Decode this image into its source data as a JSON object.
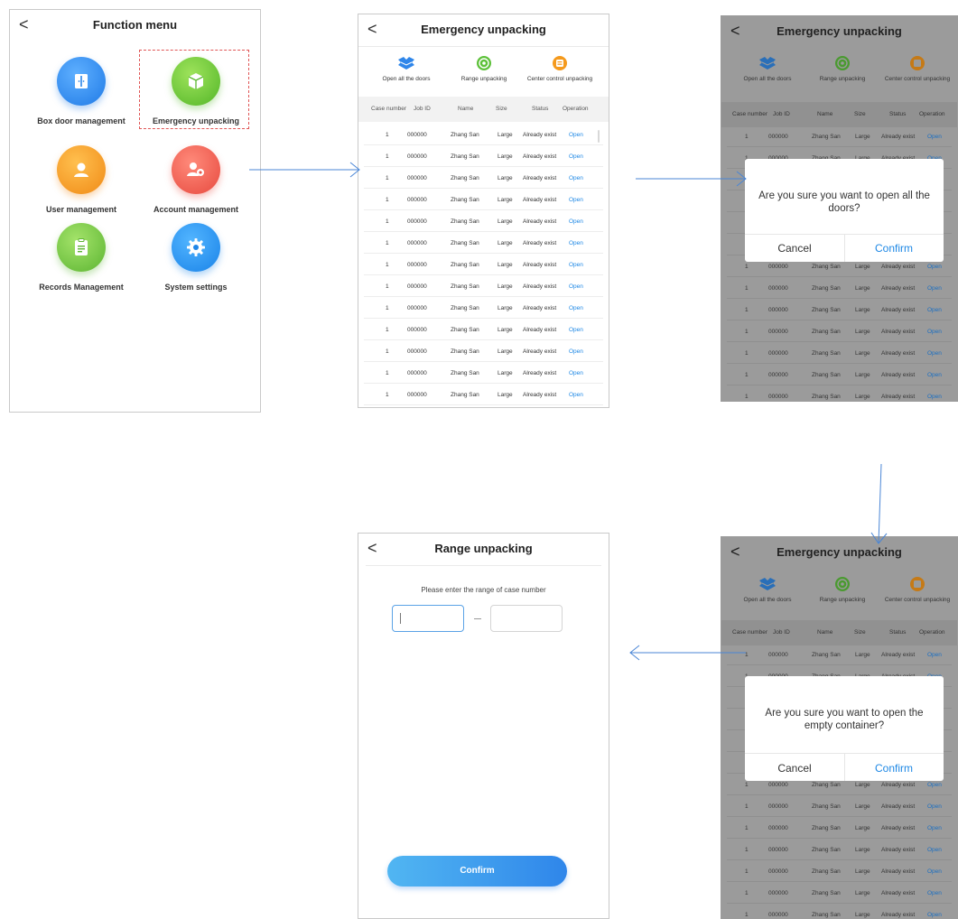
{
  "function_menu": {
    "title": "Function menu",
    "back_glyph": "<",
    "items": [
      {
        "label": "Box door management",
        "icon": "door-icon"
      },
      {
        "label": "Emergency unpacking",
        "icon": "box-icon"
      },
      {
        "label": "User management",
        "icon": "user-icon"
      },
      {
        "label": "Account management",
        "icon": "account-settings-icon"
      },
      {
        "label": "Records Management",
        "icon": "clipboard-icon"
      },
      {
        "label": "System settings",
        "icon": "gear-icon"
      }
    ]
  },
  "emergency_unpacking": {
    "title": "Emergency unpacking",
    "back_glyph": "<",
    "tools": [
      {
        "label": "Open all the doors",
        "icon": "open-box-icon"
      },
      {
        "label": "Range unpacking",
        "icon": "range-icon"
      },
      {
        "label": "Center control unpacking",
        "icon": "center-control-icon"
      }
    ],
    "columns": [
      "Case number",
      "Job ID",
      "Name",
      "Size",
      "Status",
      "Operation"
    ],
    "rows": [
      {
        "case": "1",
        "job": "000000",
        "name": "Zhang San",
        "size": "Large",
        "status": "Already exist",
        "op": "Open"
      },
      {
        "case": "1",
        "job": "000000",
        "name": "Zhang San",
        "size": "Large",
        "status": "Already exist",
        "op": "Open"
      },
      {
        "case": "1",
        "job": "000000",
        "name": "Zhang San",
        "size": "Large",
        "status": "Already exist",
        "op": "Open"
      },
      {
        "case": "1",
        "job": "000000",
        "name": "Zhang San",
        "size": "Large",
        "status": "Already exist",
        "op": "Open"
      },
      {
        "case": "1",
        "job": "000000",
        "name": "Zhang San",
        "size": "Large",
        "status": "Already exist",
        "op": "Open"
      },
      {
        "case": "1",
        "job": "000000",
        "name": "Zhang San",
        "size": "Large",
        "status": "Already exist",
        "op": "Open"
      },
      {
        "case": "1",
        "job": "000000",
        "name": "Zhang San",
        "size": "Large",
        "status": "Already exist",
        "op": "Open"
      },
      {
        "case": "1",
        "job": "000000",
        "name": "Zhang San",
        "size": "Large",
        "status": "Already exist",
        "op": "Open"
      },
      {
        "case": "1",
        "job": "000000",
        "name": "Zhang San",
        "size": "Large",
        "status": "Already exist",
        "op": "Open"
      },
      {
        "case": "1",
        "job": "000000",
        "name": "Zhang San",
        "size": "Large",
        "status": "Already exist",
        "op": "Open"
      },
      {
        "case": "1",
        "job": "000000",
        "name": "Zhang San",
        "size": "Large",
        "status": "Already exist",
        "op": "Open"
      },
      {
        "case": "1",
        "job": "000000",
        "name": "Zhang San",
        "size": "Large",
        "status": "Already exist",
        "op": "Open"
      },
      {
        "case": "1",
        "job": "000000",
        "name": "Zhang San",
        "size": "Large",
        "status": "Already exist",
        "op": "Open"
      }
    ]
  },
  "dialog_open_all": {
    "message": "Are you sure you want to open all the doors?",
    "cancel": "Cancel",
    "confirm": "Confirm"
  },
  "dialog_open_empty": {
    "message": "Are you sure you want to open the empty container?",
    "cancel": "Cancel",
    "confirm": "Confirm"
  },
  "range_unpacking": {
    "title": "Range unpacking",
    "back_glyph": "<",
    "prompt": "Please enter the range of case number",
    "from_value": "",
    "to_value": "",
    "confirm": "Confirm"
  },
  "colors": {
    "accent_blue": "#1e88e5",
    "highlight_red": "#e05555",
    "arrow_blue": "#4a86d6",
    "overlay_gray": "#9b9b9b"
  }
}
